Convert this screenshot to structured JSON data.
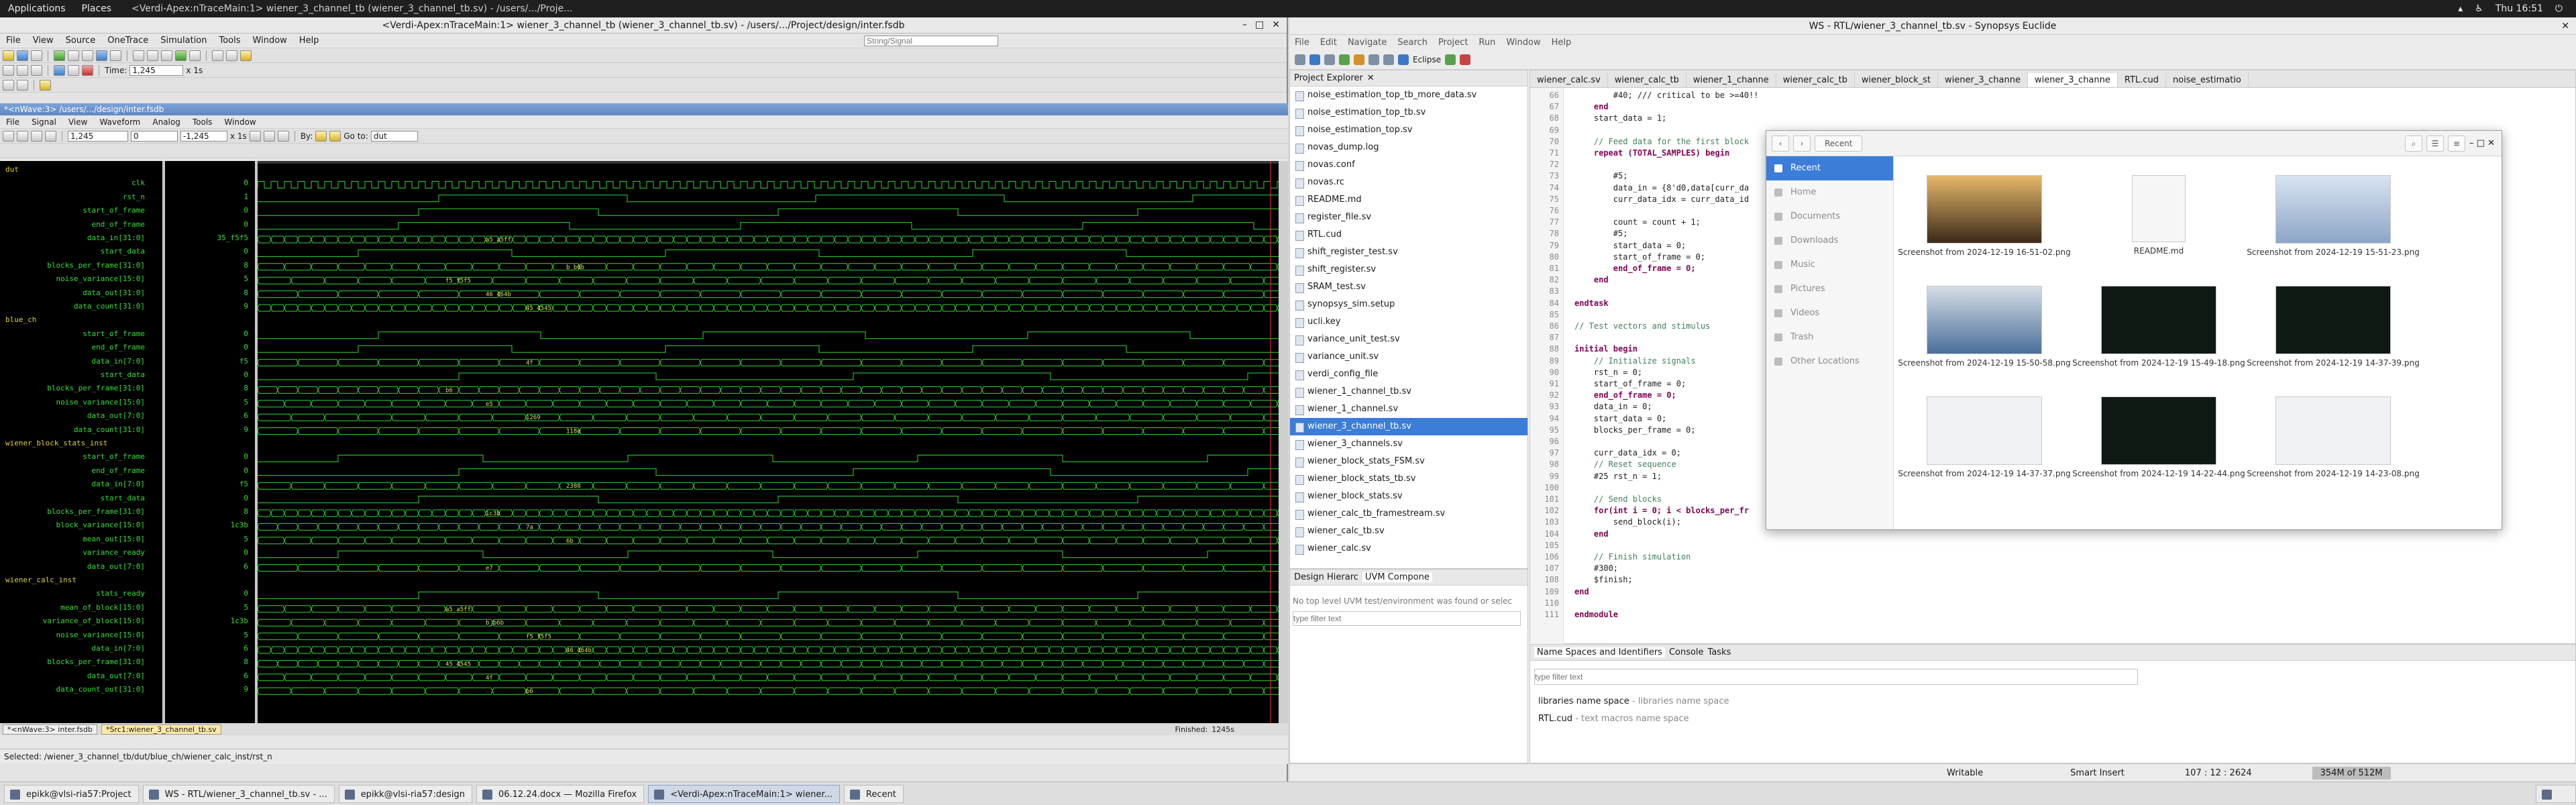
{
  "topbar": {
    "applications": "Applications",
    "places": "Places",
    "window_title": "<Verdi-Apex:nTraceMain:1> wiener_3_channel_tb (wiener_3_channel_tb.sv) - /users/.../Proje...",
    "clock": "Thu 16:51"
  },
  "verdi": {
    "title": "<Verdi-Apex:nTraceMain:1> wiener_3_channel_tb (wiener_3_channel_tb.sv) - /users/.../Project/design/inter.fsdb",
    "menus": [
      "File",
      "View",
      "Source",
      "OneTrace",
      "Simulation",
      "Tools",
      "Window",
      "Help"
    ],
    "search_placeholder": "String/Signal",
    "time_label": "Time:",
    "time_value": "1,245",
    "time_unit": "x 1s",
    "wave_title": "*<nWave:3> /users/.../design/inter.fsdb",
    "wave_menus": [
      "File",
      "Signal",
      "View",
      "Waveform",
      "Analog",
      "Tools",
      "Window"
    ],
    "cursor_a": "1,245",
    "cursor_b": "0",
    "cursor_delta": "-1,245",
    "cursor_unit": "x 1s",
    "by_label": "By:",
    "goto_label": "Go to:",
    "goto_value": "dut",
    "signals": [
      {
        "name": "dut",
        "group": true,
        "value": ""
      },
      {
        "name": "clk",
        "value": "0"
      },
      {
        "name": "rst_n",
        "value": "1"
      },
      {
        "name": "start_of_frame",
        "value": "0"
      },
      {
        "name": "end_of_frame",
        "value": "0"
      },
      {
        "name": "data_in[31:0]",
        "value": "35_f5f5"
      },
      {
        "name": "start_data",
        "value": "0"
      },
      {
        "name": "blocks_per_frame[31:0]",
        "value": "8"
      },
      {
        "name": "noise_variance[15:0]",
        "value": "5"
      },
      {
        "name": "data_out[31:0]",
        "value": "8"
      },
      {
        "name": "data_count[31:0]",
        "value": "9"
      },
      {
        "name": "blue_ch",
        "group": true,
        "value": ""
      },
      {
        "name": "start_of_frame",
        "value": "0"
      },
      {
        "name": "end_of_frame",
        "value": "0"
      },
      {
        "name": "data_in[7:0]",
        "value": "f5"
      },
      {
        "name": "start_data",
        "value": "0"
      },
      {
        "name": "blocks_per_frame[31:0]",
        "value": "8"
      },
      {
        "name": "noise_variance[15:0]",
        "value": "5"
      },
      {
        "name": "data_out[7:0]",
        "value": "6"
      },
      {
        "name": "data_count[31:0]",
        "value": "9"
      },
      {
        "name": "wiener_block_stats_inst",
        "group": true,
        "value": ""
      },
      {
        "name": "start_of_frame",
        "value": "0"
      },
      {
        "name": "end_of_frame",
        "value": "0"
      },
      {
        "name": "data_in[7:0]",
        "value": "f5"
      },
      {
        "name": "start_data",
        "value": "0"
      },
      {
        "name": "blocks_per_frame[31:0]",
        "value": "8"
      },
      {
        "name": "block_variance[15:0]",
        "value": "1c3b"
      },
      {
        "name": "mean_out[15:0]",
        "value": "5"
      },
      {
        "name": "variance_ready",
        "value": "0"
      },
      {
        "name": "data_out[7:0]",
        "value": "6"
      },
      {
        "name": "wiener_calc_inst",
        "group": true,
        "value": ""
      },
      {
        "name": "stats_ready",
        "value": "0"
      },
      {
        "name": "mean_of_block[15:0]",
        "value": "5"
      },
      {
        "name": "variance_of_block[15:0]",
        "value": "1c3b"
      },
      {
        "name": "noise_variance[15:0]",
        "value": "5"
      },
      {
        "name": "data_in[7:0]",
        "value": "6"
      },
      {
        "name": "blocks_per_frame[31:0]",
        "value": "8"
      },
      {
        "name": "data_out[7:0]",
        "value": "6"
      },
      {
        "name": "data_count_out[31:0]",
        "value": "9"
      }
    ],
    "bus_labels": [
      "a5_a5ff",
      "b_b6b",
      "f5_f5f5",
      "46_464b",
      "45_4545",
      "4f",
      "b6",
      "e5",
      "1269",
      "118e",
      "2388",
      "1c3b",
      "7a",
      "6b",
      "e7"
    ],
    "tabs": [
      "*<nWave:3> inter.fsdb",
      "*Src1:wiener_3_channel_tb.sv"
    ],
    "finished": "Finished:",
    "finished_time": "1245s",
    "status": "Selected: /wiener_3_channel_tb/dut/blue_ch/wiener_calc_inst/rst_n"
  },
  "ide": {
    "title": "WS - RTL/wiener_3_channel_tb.sv - Synopsys Euclide",
    "menus": [
      "File",
      "Edit",
      "Navigate",
      "Search",
      "Project",
      "Run",
      "Window",
      "Help"
    ],
    "perspective": "Eclipse",
    "project_explorer": "Project Explorer",
    "files": [
      "noise_estimation_top_tb_more_data.sv",
      "noise_estimation_top_tb.sv",
      "noise_estimation_top.sv",
      "novas_dump.log",
      "novas.conf",
      "novas.rc",
      "README.md",
      "register_file.sv",
      "RTL.cud",
      "shift_register_test.sv",
      "shift_register.sv",
      "SRAM_test.sv",
      "synopsys_sim.setup",
      "ucli.key",
      "variance_unit_test.sv",
      "variance_unit.sv",
      "verdi_config_file",
      "wiener_1_channel_tb.sv",
      "wiener_1_channel.sv",
      "wiener_3_channel_tb.sv",
      "wiener_3_channels.sv",
      "wiener_block_stats_FSM.sv",
      "wiener_block_stats_tb.sv",
      "wiener_block_stats.sv",
      "wiener_calc_tb_framestream.sv",
      "wiener_calc_tb.sv",
      "wiener_calc.sv"
    ],
    "selected_file": "wiener_3_channel_tb.sv",
    "hier_tabs": [
      "Design Hierarc",
      "UVM Compone"
    ],
    "hier_message": "No top level UVM test/environment was found or selec",
    "filter_placeholder": "type filter text",
    "editor_tabs": [
      "wiener_calc.sv",
      "wiener_calc_tb",
      "wiener_1_channe",
      "wiener_calc_tb",
      "wiener_block_st",
      "wiener_3_channe",
      "wiener_3_channe",
      "RTL.cud",
      "noise_estimatio"
    ],
    "code_lines": [
      {
        "n": "66",
        "t": "        #40; /// critical to be >=40!!"
      },
      {
        "n": "67",
        "t": "    end"
      },
      {
        "n": "68",
        "t": "    start_data = 1;"
      },
      {
        "n": "69",
        "t": ""
      },
      {
        "n": "70",
        "t": "    // Feed data for the first block"
      },
      {
        "n": "71",
        "t": "    repeat (TOTAL_SAMPLES) begin"
      },
      {
        "n": "72",
        "t": ""
      },
      {
        "n": "73",
        "t": "        #5;"
      },
      {
        "n": "74",
        "t": "        data_in = {8'd0,data[curr_da"
      },
      {
        "n": "75",
        "t": "        curr_data_idx = curr_data_id"
      },
      {
        "n": "76",
        "t": ""
      },
      {
        "n": "77",
        "t": "        count = count + 1;"
      },
      {
        "n": "78",
        "t": "        #5;"
      },
      {
        "n": "79",
        "t": "        start_data = 0;"
      },
      {
        "n": "80",
        "t": "        start_of_frame = 0;"
      },
      {
        "n": "81",
        "t": "        end_of_frame = 0;"
      },
      {
        "n": "82",
        "t": "    end"
      },
      {
        "n": "83",
        "t": ""
      },
      {
        "n": "84",
        "t": "endtask"
      },
      {
        "n": "85",
        "t": ""
      },
      {
        "n": "86",
        "t": "// Test vectors and stimulus"
      },
      {
        "n": "87",
        "t": ""
      },
      {
        "n": "88",
        "t": "initial begin"
      },
      {
        "n": "89",
        "t": "    // Initialize signals"
      },
      {
        "n": "90",
        "t": "    rst_n = 0;"
      },
      {
        "n": "91",
        "t": "    start_of_frame = 0;"
      },
      {
        "n": "92",
        "t": "    end_of_frame = 0;"
      },
      {
        "n": "93",
        "t": "    data_in = 0;"
      },
      {
        "n": "94",
        "t": "    start_data = 0;"
      },
      {
        "n": "95",
        "t": "    blocks_per_frame = 0;"
      },
      {
        "n": "96",
        "t": ""
      },
      {
        "n": "97",
        "t": "    curr_data_idx = 0;"
      },
      {
        "n": "98",
        "t": "    // Reset sequence"
      },
      {
        "n": "99",
        "t": "    #25 rst_n = 1;"
      },
      {
        "n": "100",
        "t": ""
      },
      {
        "n": "101",
        "t": "    // Send blocks"
      },
      {
        "n": "102",
        "t": "    for(int i = 0; i < blocks_per_fr"
      },
      {
        "n": "103",
        "t": "        send_block(i);"
      },
      {
        "n": "104",
        "t": "    end"
      },
      {
        "n": "105",
        "t": ""
      },
      {
        "n": "106",
        "t": "    // Finish simulation"
      },
      {
        "n": "107",
        "t": "    #300;"
      },
      {
        "n": "108",
        "t": "    $finish;"
      },
      {
        "n": "109",
        "t": "end"
      },
      {
        "n": "110",
        "t": ""
      },
      {
        "n": "111",
        "t": "endmodule"
      }
    ],
    "bottom_tabs": [
      "Name Spaces and Identifiers",
      "Console",
      "Tasks"
    ],
    "ns_items": [
      {
        "name": "libraries name space",
        "desc": "- libraries name space"
      },
      {
        "name": "RTL.cud",
        "desc": "- text macros name space"
      }
    ],
    "status_writable": "Writable",
    "status_insert": "Smart Insert",
    "status_pos": "107 : 12 : 2624",
    "status_mem": "354M of 512M"
  },
  "files_dialog": {
    "location": "Recent",
    "sidebar": [
      "Recent",
      "Home",
      "Documents",
      "Downloads",
      "Music",
      "Pictures",
      "Videos",
      "Trash",
      "Other Locations"
    ],
    "thumbs": [
      {
        "name": "Screenshot from 2024-12-19 16-51-02.png"
      },
      {
        "name": "README.md"
      },
      {
        "name": "Screenshot from 2024-12-19 15-51-23.png"
      },
      {
        "name": "Screenshot from 2024-12-19 15-50-58.png"
      },
      {
        "name": "Screenshot from 2024-12-19 15-49-18.png"
      },
      {
        "name": "Screenshot from 2024-12-19 14-37-39.png"
      },
      {
        "name": "Screenshot from 2024-12-19 14-37-37.png"
      },
      {
        "name": "Screenshot from 2024-12-19 14-22-44.png"
      },
      {
        "name": "Screenshot from 2024-12-19 14-23-08.png"
      }
    ]
  },
  "taskbar": {
    "tasks": [
      "epikk@vlsi-ria57:Project",
      "WS - RTL/wiener_3_channel_tb.sv - ...",
      "epikk@vlsi-ria57:design",
      "06.12.24.docx — Mozilla Firefox",
      "<Verdi-Apex:nTraceMain:1> wiener...",
      "Recent"
    ]
  }
}
